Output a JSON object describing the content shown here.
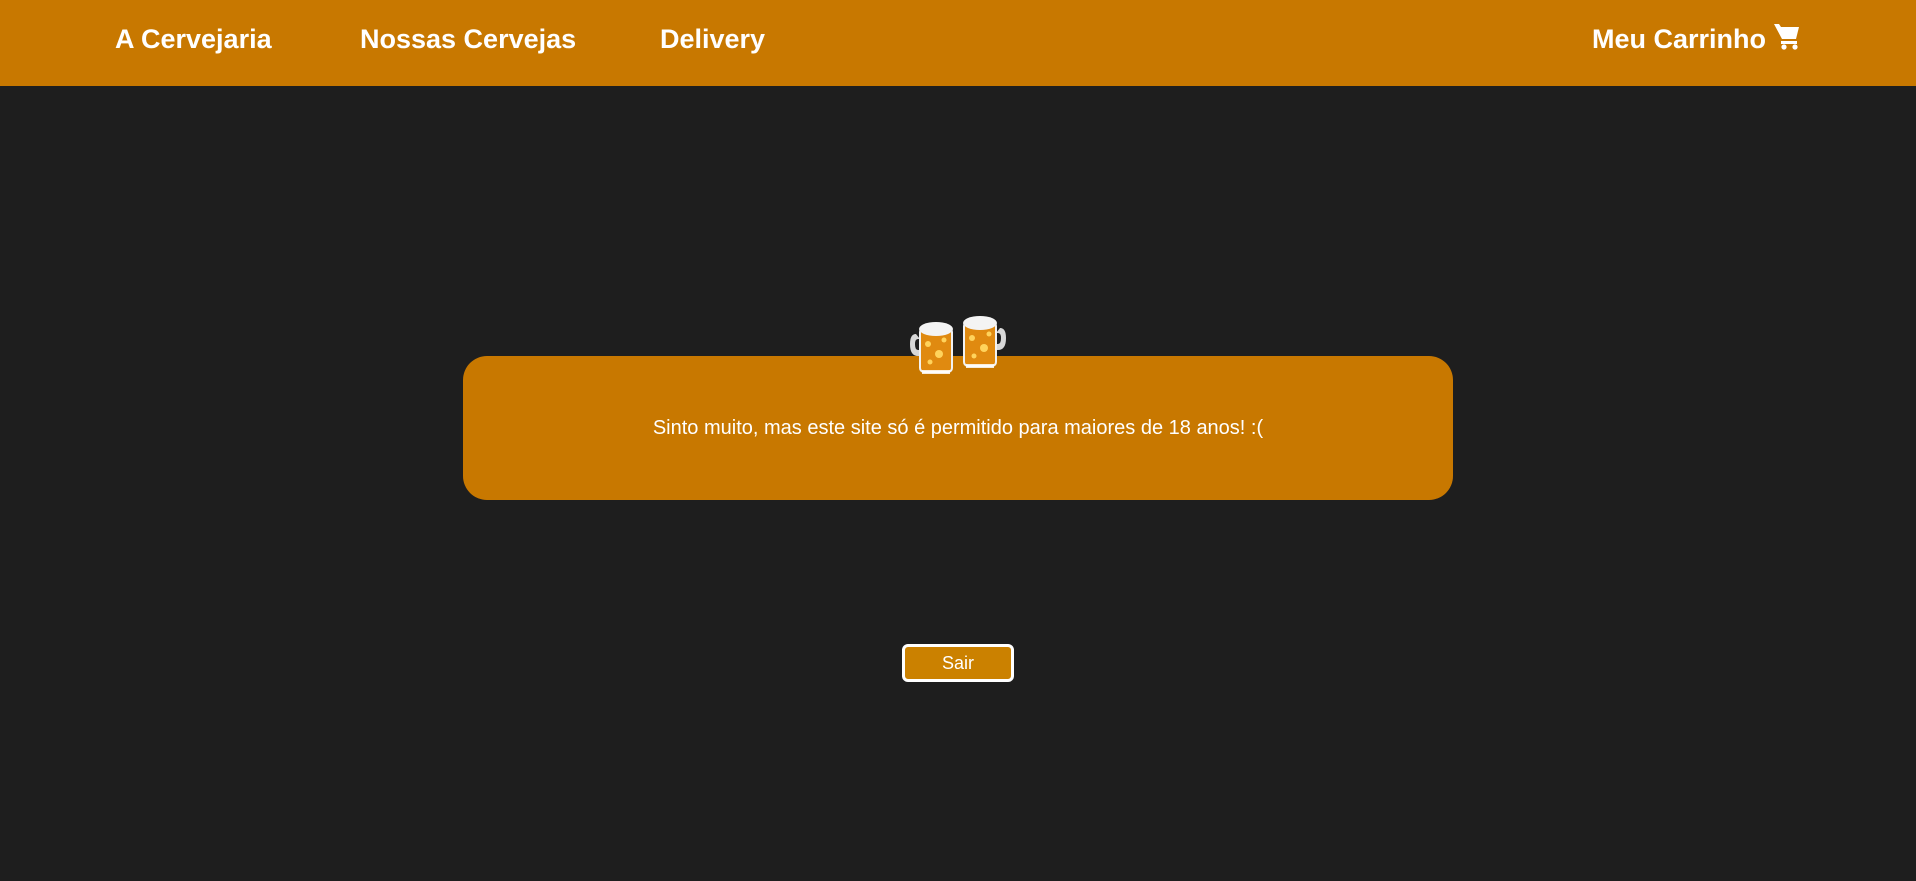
{
  "nav": {
    "items": [
      {
        "label": "A Cervejaria"
      },
      {
        "label": "Nossas Cervejas"
      },
      {
        "label": "Delivery"
      }
    ],
    "cart_label": "Meu Carrinho",
    "cart_icon": "shopping-cart-icon"
  },
  "main": {
    "icon": "beer-mugs-icon",
    "message": "Sinto muito, mas este site só é permitido para maiores de 18 anos! :(",
    "exit_label": "Sair"
  },
  "colors": {
    "header_bg": "#c87800",
    "page_bg": "#1e1e1e",
    "card_bg": "#c87800",
    "button_bg": "#cb8100",
    "text": "#ffffff"
  }
}
